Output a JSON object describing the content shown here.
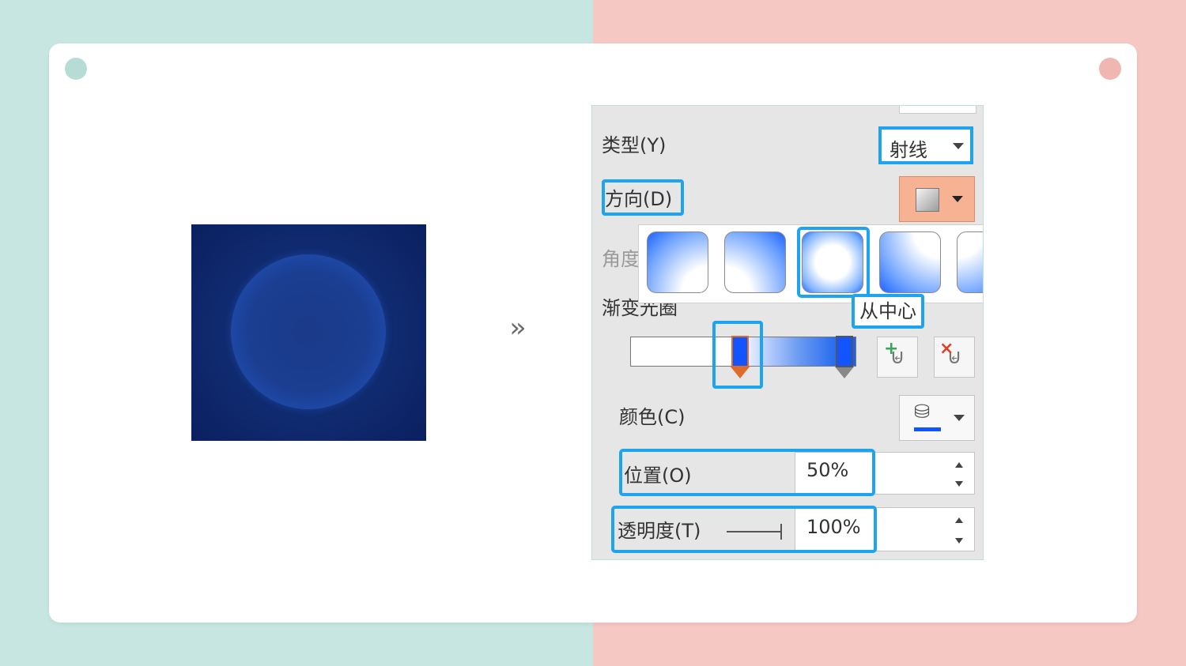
{
  "preview": {
    "background_colors": [
      "#0a2060",
      "#1a3a85"
    ],
    "circle_edge_color": "#2a63d8"
  },
  "arrow_icon": "double-chevron-right",
  "panel": {
    "type": {
      "label": "类型(Y)",
      "value": "射线"
    },
    "direction": {
      "label": "方向(D)"
    },
    "angle": {
      "label": "角度"
    },
    "gradient_stops": {
      "label": "渐变光圈"
    },
    "gallery": {
      "tiles": [
        "from-corner-top-left",
        "from-corner-top-right",
        "from-center",
        "from-corner-bottom-left",
        "from-corner-bottom-right"
      ],
      "selected_index": 2,
      "tooltip": "从中心"
    },
    "stops": [
      {
        "position": 50,
        "color": "#1255ff",
        "selected": true
      },
      {
        "position": 100,
        "color": "#1255ff",
        "selected": false
      }
    ],
    "color": {
      "label": "颜色(C)",
      "value": "#1255ff"
    },
    "position": {
      "label": "位置(O)",
      "value": "50%"
    },
    "transparency": {
      "label": "透明度(T)",
      "value": "100%"
    },
    "accent_color": "#1ea3f0"
  }
}
